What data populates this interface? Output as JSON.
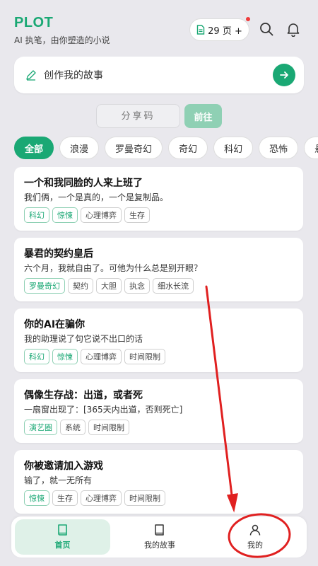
{
  "app": {
    "title": "PLOT",
    "subtitle": "AI 执笔，由你塑造的小说"
  },
  "header": {
    "pages_label": "29 页 +",
    "has_notification_dot": true
  },
  "create": {
    "label": "创作我的故事"
  },
  "share": {
    "placeholder": "分享码",
    "go_label": "前往"
  },
  "categories": [
    "全部",
    "浪漫",
    "罗曼奇幻",
    "奇幻",
    "科幻",
    "恐怖",
    "悬"
  ],
  "stories": [
    {
      "title": "一个和我同脸的人来上班了",
      "desc": "我们俩，一个是真的，一个是复制品。",
      "tags": [
        {
          "t": "科幻",
          "g": true
        },
        {
          "t": "惊悚",
          "g": true
        },
        {
          "t": "心理博弈",
          "g": false
        },
        {
          "t": "生存",
          "g": false
        }
      ]
    },
    {
      "title": "暴君的契约皇后",
      "desc": "六个月，我就自由了。可他为什么总是别开眼？",
      "tags": [
        {
          "t": "罗曼奇幻",
          "g": true
        },
        {
          "t": "契约",
          "g": false
        },
        {
          "t": "大胆",
          "g": false
        },
        {
          "t": "执念",
          "g": false
        },
        {
          "t": "细水长流",
          "g": false
        }
      ]
    },
    {
      "title": "你的AI在骗你",
      "desc": "我的助理说了句它说不出口的话",
      "tags": [
        {
          "t": "科幻",
          "g": true
        },
        {
          "t": "惊悚",
          "g": true
        },
        {
          "t": "心理博弈",
          "g": false
        },
        {
          "t": "时间限制",
          "g": false
        }
      ]
    },
    {
      "title": "偶像生存战：出道，或者死",
      "desc": "一扇窗出现了：[365天内出道，否则死亡]",
      "tags": [
        {
          "t": "演艺圈",
          "g": true
        },
        {
          "t": "系统",
          "g": false
        },
        {
          "t": "时间限制",
          "g": false
        }
      ]
    },
    {
      "title": "你被邀请加入游戏",
      "desc": "输了，就一无所有",
      "tags": [
        {
          "t": "惊悚",
          "g": true
        },
        {
          "t": "生存",
          "g": false
        },
        {
          "t": "心理博弈",
          "g": false
        },
        {
          "t": "时间限制",
          "g": false
        }
      ]
    }
  ],
  "tabs": {
    "home": "首页",
    "stories": "我的故事",
    "mine": "我的"
  },
  "colors": {
    "accent": "#1aa874",
    "annotation": "#e02020"
  }
}
